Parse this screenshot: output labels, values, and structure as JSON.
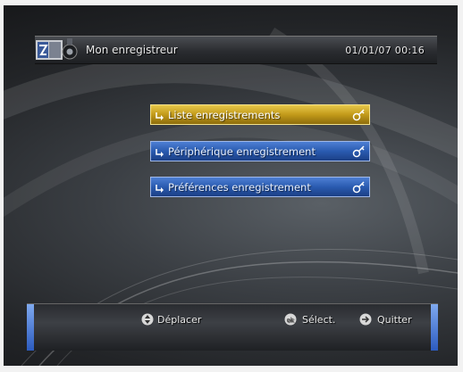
{
  "header": {
    "title": "Mon enregistreur",
    "datetime": "01/01/07 00:16"
  },
  "menu": {
    "items": [
      {
        "label": "Liste enregistrements",
        "selected": true
      },
      {
        "label": "Périphérique enregistrement",
        "selected": false
      },
      {
        "label": "Préférences enregistrement",
        "selected": false
      }
    ]
  },
  "footer": {
    "move_label": "Déplacer",
    "select_label": "Sélect.",
    "quit_label": "Quitter"
  },
  "colors": {
    "selected": "#d4b030",
    "item": "#2f63bd"
  }
}
